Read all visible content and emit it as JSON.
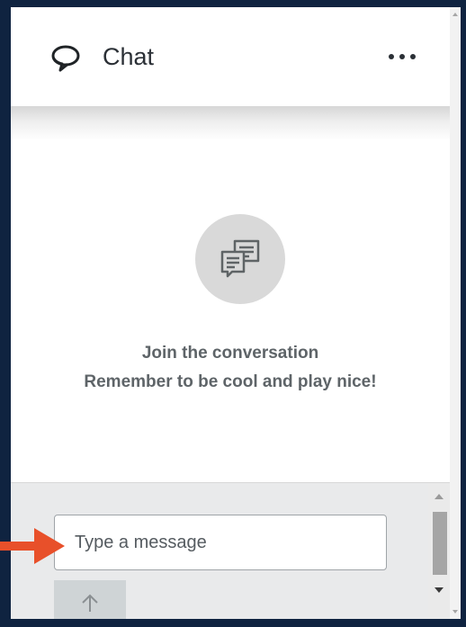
{
  "header": {
    "title": "Chat",
    "title_icon": "speech-bubble-icon",
    "more_icon": "more-horizontal-icon"
  },
  "empty_state": {
    "icon": "chat-bubbles-icon",
    "line1": "Join the conversation",
    "line2": "Remember to be cool and play nice!"
  },
  "composer": {
    "placeholder": "Type a message",
    "value": "",
    "send_icon": "arrow-up-icon"
  },
  "colors": {
    "background": "#0f2340",
    "panel": "#ffffff",
    "composer_bg": "#e9eaeb",
    "text_dark": "#2b3036",
    "text_muted": "#5e6468",
    "pointer": "#e8502a"
  }
}
